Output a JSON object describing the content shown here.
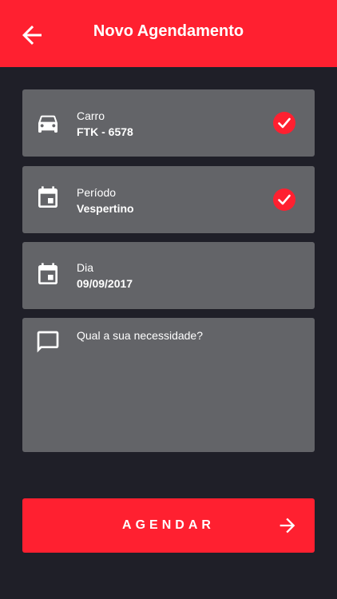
{
  "header": {
    "title": "Novo Agendamento",
    "back_icon": "arrow-left-icon"
  },
  "fields": {
    "car": {
      "label": "Carro",
      "value": "FTK - 6578",
      "icon": "car-icon",
      "checked": true
    },
    "period": {
      "label": "Período",
      "value": "Vespertino",
      "icon": "calendar-icon",
      "checked": true
    },
    "day": {
      "label": "Dia",
      "value": "09/09/2017",
      "icon": "calendar-icon",
      "checked": false
    },
    "need": {
      "placeholder": "Qual a sua necessidade?",
      "value": "",
      "icon": "message-icon"
    }
  },
  "submit": {
    "label": "AGENDAR",
    "icon": "arrow-right-icon"
  },
  "colors": {
    "accent": "#ff2030",
    "background": "#1f1f28",
    "card": "#636468",
    "text": "#ffffff"
  }
}
